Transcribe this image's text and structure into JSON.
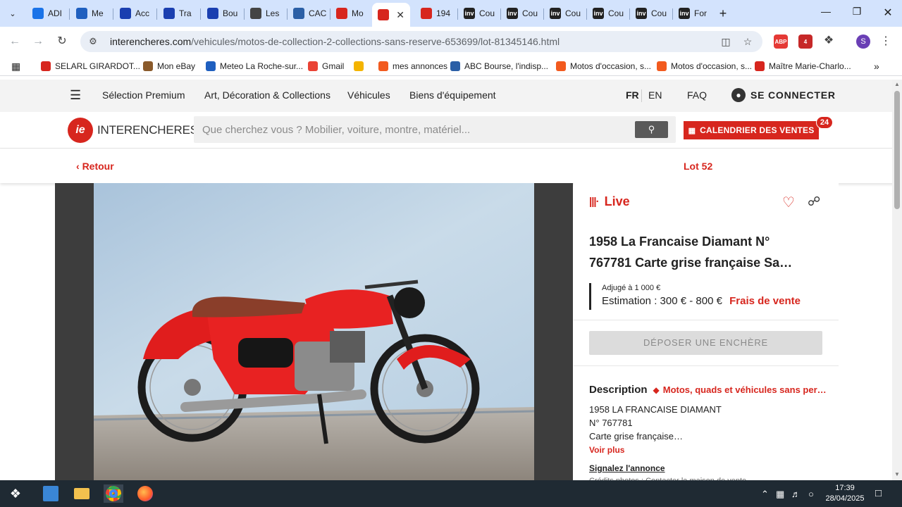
{
  "browser": {
    "tabs": [
      {
        "title": "ADI",
        "favicon": "list-icon",
        "color": "#1a73e8"
      },
      {
        "title": "Me",
        "favicon": "meteo-icon",
        "color": "#1f5fbf"
      },
      {
        "title": "Acc",
        "favicon": "arrow-icon",
        "color": "#1a3fb0"
      },
      {
        "title": "Tra",
        "favicon": "arrow-icon",
        "color": "#1a3fb0"
      },
      {
        "title": "Bou",
        "favicon": "arrow-icon",
        "color": "#1a3fb0"
      },
      {
        "title": "Les",
        "favicon": "globe-icon",
        "color": "#444444"
      },
      {
        "title": "CAC",
        "favicon": "abc-icon",
        "color": "#2b5fa6"
      },
      {
        "title": "Mo",
        "favicon": "interencheres-icon",
        "color": "#d7261e"
      },
      {
        "title": "",
        "favicon": "interencheres-icon",
        "color": "#d7261e",
        "active": true
      },
      {
        "title": "194",
        "favicon": "interencheres-icon",
        "color": "#d7261e"
      },
      {
        "title": "Cou",
        "favicon": "inv-icon",
        "color": "#222222"
      },
      {
        "title": "Cou",
        "favicon": "inv-icon",
        "color": "#222222"
      },
      {
        "title": "Cou",
        "favicon": "inv-icon",
        "color": "#222222"
      },
      {
        "title": "Cou",
        "favicon": "inv-icon",
        "color": "#222222"
      },
      {
        "title": "Cou",
        "favicon": "inv-icon",
        "color": "#222222"
      },
      {
        "title": "For",
        "favicon": "inv-icon",
        "color": "#222222"
      }
    ],
    "inv_text": "inv",
    "url_host": "interencheres.com",
    "url_path": "/vehicules/motos-de-collection-2-collections-sans-reserve-653699/lot-81345146.html",
    "profile_initial": "S",
    "ext_badge": "4",
    "abp": "ABP",
    "bookmarks": [
      {
        "label": "SELARL GIRARDOT...",
        "color": "#d7261e"
      },
      {
        "label": "Mon eBay",
        "color": "#8a5a2b"
      },
      {
        "label": "Meteo La Roche-sur...",
        "color": "#1f5fbf"
      },
      {
        "label": "Gmail",
        "color": "#ea4335"
      },
      {
        "label": "",
        "color": "#f4b400"
      },
      {
        "label": "mes annonces",
        "color": "#f25a1e"
      },
      {
        "label": "ABC Bourse, l'indisp...",
        "color": "#2b5fa6"
      },
      {
        "label": "Motos d'occasion, s...",
        "color": "#f25a1e"
      },
      {
        "label": "Motos d'occasion, s...",
        "color": "#f25a1e"
      },
      {
        "label": "Maître Marie-Charlo...",
        "color": "#d7261e"
      }
    ]
  },
  "site": {
    "nav": [
      "Sélection Premium",
      "Art, Décoration & Collections",
      "Véhicules",
      "Biens d'équipement"
    ],
    "lang_fr": "FR",
    "lang_en": "EN",
    "faq": "FAQ",
    "login": "SE CONNECTER",
    "logo_mark": "ie",
    "logo_text": "INTERENCHERES",
    "search_placeholder": "Que cherchez vous ? Mobilier, voiture, montre, matériel...",
    "calendar_label": "CALENDRIER DES VENTES",
    "calendar_count": "24",
    "back": "Retour",
    "lot": "Lot 52"
  },
  "lot": {
    "live": "Live",
    "title_line1": "1958 La Francaise Diamant N°",
    "title_line2": "767781 Carte grise française Sa…",
    "adjuge": "Adjugé à 1 000 €",
    "estimation": "Estimation : 300 € - 800 €",
    "frais": "Frais de vente",
    "bid_button": "DÉPOSER UNE ENCHÈRE",
    "description_label": "Description",
    "category": "Motos, quads et véhicules sans per…",
    "desc_lines": [
      "1958 LA FRANCAISE DIAMANT",
      "N° 767781",
      "Carte grise française…"
    ],
    "voir_plus": "Voir plus",
    "signal": "Signalez l'annonce",
    "credits": "Crédits photos : Contacter la maison de vente"
  },
  "taskbar": {
    "time": "17:39",
    "date": "28/04/2025"
  },
  "colors": {
    "accent": "#d7261e",
    "tabstrip": "#d3e3fd"
  }
}
